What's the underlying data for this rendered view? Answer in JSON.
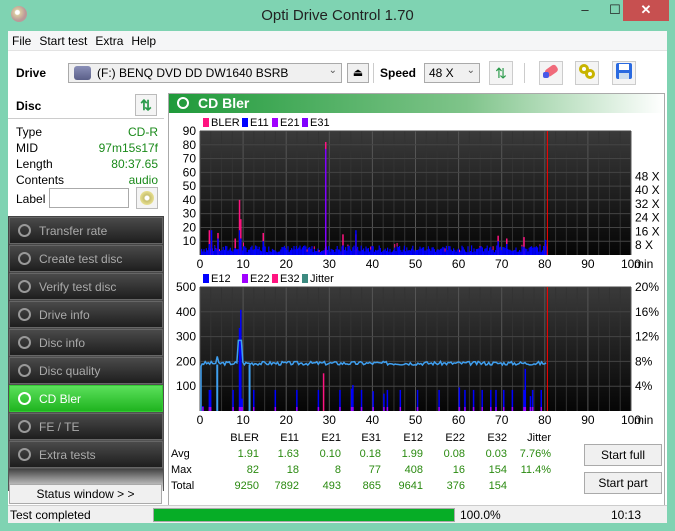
{
  "window": {
    "title": "Opti Drive Control 1.70",
    "minimize": "‒",
    "maximize": "☐",
    "close": "✕"
  },
  "menu": [
    "File",
    "Start test",
    "Extra",
    "Help"
  ],
  "toolbar": {
    "drive_label": "Drive",
    "drive_value": "(F:)   BENQ DVD DD DW1640 BSRB",
    "speed_label": "Speed",
    "speed_value": "48 X",
    "eject_icon": "⏏",
    "refresh_icon": "⇅",
    "erase_icon": "eraser",
    "settings_icon": "gears",
    "save_icon": "floppy"
  },
  "disc": {
    "title": "Disc",
    "rows": [
      {
        "key": "Type",
        "value": "CD-R"
      },
      {
        "key": "MID",
        "value": "97m15s17f"
      },
      {
        "key": "Length",
        "value": "80:37.65"
      },
      {
        "key": "Contents",
        "value": "audio"
      }
    ],
    "label_key": "Label",
    "label_value": ""
  },
  "nav": [
    {
      "label": "Transfer rate",
      "active": false
    },
    {
      "label": "Create test disc",
      "active": false
    },
    {
      "label": "Verify test disc",
      "active": false
    },
    {
      "label": "Drive info",
      "active": false
    },
    {
      "label": "Disc info",
      "active": false
    },
    {
      "label": "Disc quality",
      "active": false
    },
    {
      "label": "CD Bler",
      "active": true
    },
    {
      "label": "FE / TE",
      "active": false
    },
    {
      "label": "Extra tests",
      "active": false
    }
  ],
  "status_window_btn": "Status window > >",
  "panel_title": "CD Bler",
  "colors": {
    "bler": "#ff1480",
    "e11": "#0000ff",
    "e21": "#a000ff",
    "e31": "#8000ff",
    "e12": "#0000ff",
    "e22": "#a000ff",
    "e32": "#ff1480",
    "jitter": "#3f9fef",
    "marker": "#ff0000",
    "progress": "#06ad26"
  },
  "chart_data": [
    {
      "type": "bar",
      "title": "CD Bler top",
      "legend": [
        "BLER",
        "E11",
        "E21",
        "E31"
      ],
      "legend_position": "top-left",
      "x_ticks": [
        0,
        10,
        20,
        30,
        40,
        50,
        60,
        70,
        80,
        90,
        100
      ],
      "x_unit": "min",
      "xlim": [
        0,
        100
      ],
      "y_ticks": [
        10,
        20,
        30,
        40,
        50,
        60,
        70,
        80,
        90
      ],
      "ylim": [
        0,
        90
      ],
      "y2_ticks": [
        "8 X",
        "16 X",
        "24 X",
        "32 X",
        "40 X",
        "48 X"
      ],
      "end_marker_min": 80.6,
      "spikes": [
        {
          "x": 2,
          "bler": 18,
          "e11": 8
        },
        {
          "x": 2.5,
          "bler": 10,
          "e11": 18
        },
        {
          "x": 4,
          "bler": 16,
          "e11": 12
        },
        {
          "x": 8,
          "bler": 12,
          "e11": 5
        },
        {
          "x": 9,
          "bler": 40,
          "e11": 18
        },
        {
          "x": 9.3,
          "bler": 26,
          "e11": 12
        },
        {
          "x": 14.5,
          "bler": 16,
          "e11": 10
        },
        {
          "x": 29,
          "bler": 82,
          "e31": 77
        },
        {
          "x": 33,
          "bler": 15,
          "e11": 7
        },
        {
          "x": 36,
          "bler": 15,
          "e11": 18
        },
        {
          "x": 69,
          "bler": 14,
          "e11": 10
        },
        {
          "x": 71,
          "bler": 12,
          "e11": 8
        },
        {
          "x": 75,
          "bler": 13,
          "e11": 6
        },
        {
          "x": 80,
          "bler": 8,
          "e11": 11
        }
      ],
      "baseline_bler": 4
    },
    {
      "type": "bar",
      "title": "CD Bler bottom",
      "legend": [
        "E12",
        "E22",
        "E32",
        "Jitter"
      ],
      "legend_position": "top-left",
      "x_ticks": [
        0,
        10,
        20,
        30,
        40,
        50,
        60,
        70,
        80,
        90,
        100
      ],
      "x_unit": "min",
      "xlim": [
        0,
        100
      ],
      "y_ticks": [
        100,
        200,
        300,
        400,
        500
      ],
      "ylim": [
        0,
        500
      ],
      "y2_ticks": [
        "4%",
        "8%",
        "12%",
        "16%",
        "20%"
      ],
      "y2lim": [
        0,
        20
      ],
      "end_marker_min": 80.6,
      "e12_spikes": [
        [
          0.5,
          20
        ],
        [
          2,
          85
        ],
        [
          2.3,
          85
        ],
        [
          7.5,
          85
        ],
        [
          9,
          335
        ],
        [
          9.3,
          408
        ],
        [
          9.6,
          50
        ],
        [
          12.3,
          85
        ],
        [
          17.3,
          85
        ],
        [
          22.3,
          85
        ],
        [
          27.3,
          85
        ],
        [
          32.3,
          85
        ],
        [
          35,
          90
        ],
        [
          35.3,
          105
        ],
        [
          37.3,
          85
        ],
        [
          40,
          80
        ],
        [
          42.5,
          70
        ],
        [
          43.3,
          85
        ],
        [
          46.3,
          85
        ],
        [
          50.3,
          85
        ],
        [
          55.3,
          85
        ],
        [
          60,
          95
        ],
        [
          61.3,
          85
        ],
        [
          63.3,
          85
        ],
        [
          65.3,
          85
        ],
        [
          67.3,
          85
        ],
        [
          68.5,
          85
        ],
        [
          70.3,
          85
        ],
        [
          72.3,
          85
        ],
        [
          75,
          85
        ],
        [
          75.3,
          170
        ],
        [
          76.5,
          60
        ],
        [
          77,
          85
        ],
        [
          79,
          85
        ]
      ],
      "e32_spikes": [
        [
          28.5,
          152
        ]
      ],
      "jitter_avg_pct": 7.76
    }
  ],
  "stats": {
    "columns": [
      "BLER",
      "E11",
      "E21",
      "E31",
      "E12",
      "E22",
      "E32",
      "Jitter"
    ],
    "rows": [
      {
        "label": "Avg",
        "values": [
          "1.91",
          "1.63",
          "0.10",
          "0.18",
          "1.99",
          "0.08",
          "0.03",
          "7.76%"
        ]
      },
      {
        "label": "Max",
        "values": [
          "82",
          "18",
          "8",
          "77",
          "408",
          "16",
          "154",
          "11.4%"
        ]
      },
      {
        "label": "Total",
        "values": [
          "9250",
          "7892",
          "493",
          "865",
          "9641",
          "376",
          "154",
          ""
        ]
      }
    ]
  },
  "buttons": {
    "start_full": "Start full",
    "start_part": "Start part"
  },
  "statusbar": {
    "text": "Test completed",
    "progress_pct": 100,
    "progress_text": "100.0%",
    "time": "10:13"
  }
}
